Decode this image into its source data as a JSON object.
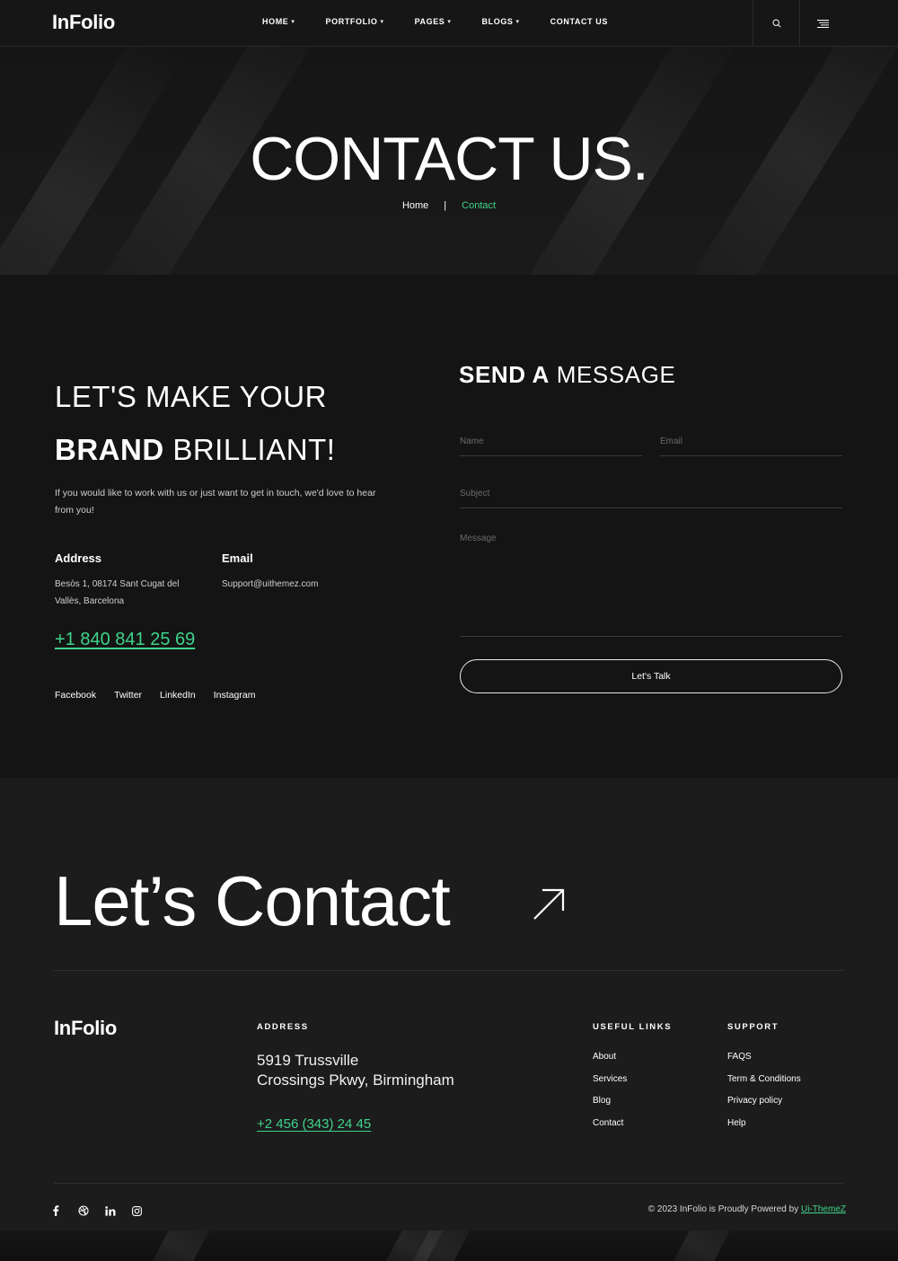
{
  "brand": {
    "logo": "InFolio"
  },
  "nav": {
    "items": [
      {
        "label": "HOME",
        "has_dropdown": true
      },
      {
        "label": "PORTFOLIO",
        "has_dropdown": true
      },
      {
        "label": "PAGES",
        "has_dropdown": true
      },
      {
        "label": "BLOGS",
        "has_dropdown": true
      },
      {
        "label": "CONTACT US",
        "has_dropdown": false
      }
    ],
    "caret": "▾",
    "search_icon": "search-icon",
    "menu_icon": "hamburger-menu-icon"
  },
  "hero": {
    "title": "CONTACT US.",
    "breadcrumb": {
      "home": "Home",
      "separator": "|",
      "current": "Contact"
    }
  },
  "intro": {
    "heading_line1": "LET'S MAKE YOUR",
    "heading_bold": "BRAND",
    "heading_rest": " BRILLIANT!",
    "text": "If you would like to work with us or just want to get in touch, we'd love to hear from you!",
    "address_label": "Address",
    "address_text": "Besòs 1, 08174 Sant Cugat del Vallès, Barcelona",
    "email_label": "Email",
    "email_text": "Support@uithemez.com",
    "phone": "+1 840 841 25 69",
    "socials": [
      "Facebook",
      "Twitter",
      "LinkedIn",
      "Instagram"
    ]
  },
  "form": {
    "title_bold": "SEND A",
    "title_rest": " MESSAGE",
    "name_placeholder": "Name",
    "email_placeholder": "Email",
    "subject_placeholder": "Subject",
    "message_placeholder": "Message",
    "submit_label": "Let's Talk"
  },
  "footer": {
    "cta": "Let’s Contact",
    "cta_icon": "arrow-up-right-icon",
    "logo": "InFolio",
    "address_title": "ADDRESS",
    "address_line1": "5919 Trussville",
    "address_line2": "Crossings Pkwy, Birmingham",
    "phone": "+2 456 (343) 24 45",
    "useful_links_title": "USEFUL LINKS",
    "useful_links": [
      "About",
      "Services",
      "Blog",
      "Contact"
    ],
    "support_title": "SUPPORT",
    "support_links": [
      "FAQS",
      "Term & Conditions",
      "Privacy policy",
      "Help"
    ],
    "social_icons": [
      "facebook-icon",
      "dribbble-icon",
      "linkedin-icon",
      "instagram-icon"
    ],
    "copyright_text": "© 2023 InFolio is Proudly Powered by ",
    "copyright_link": "Ui-ThemeZ"
  },
  "colors": {
    "accent": "#3fd48a",
    "background": "#141414",
    "footer_bg": "#1c1c1c"
  }
}
